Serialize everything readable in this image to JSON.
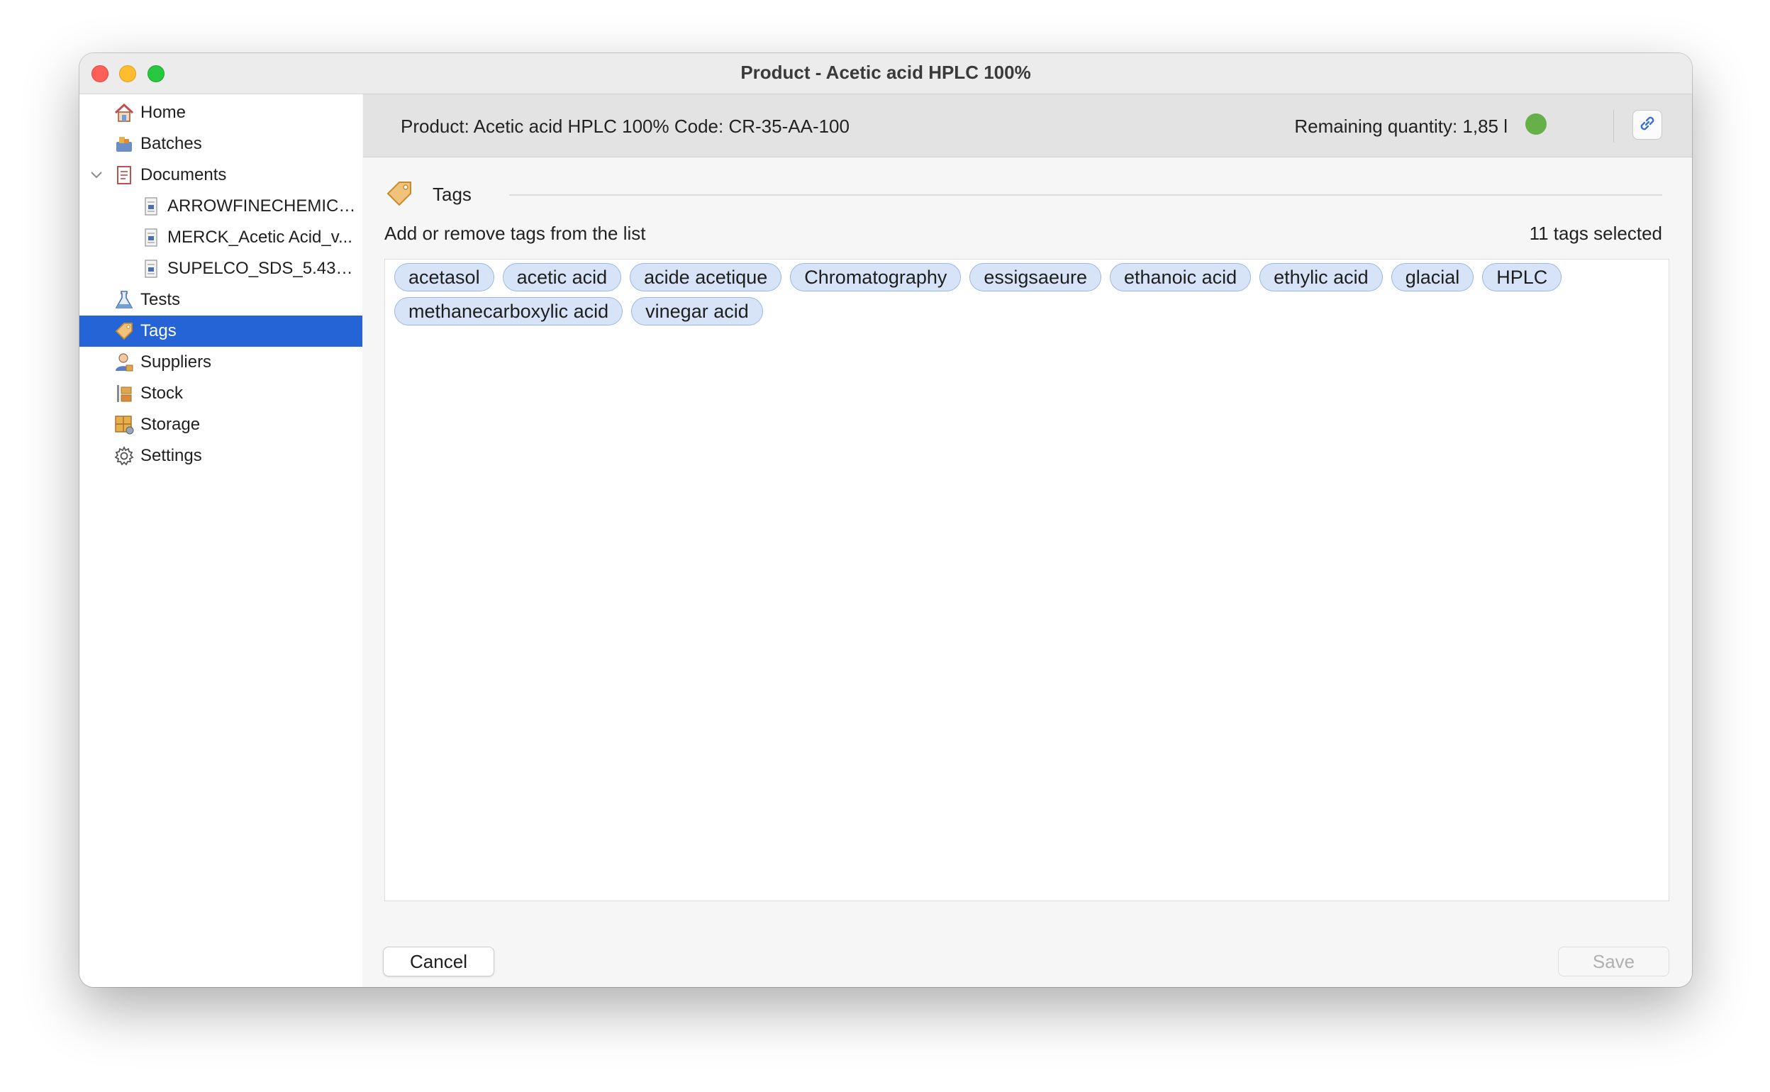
{
  "window": {
    "title": "Product - Acetic acid HPLC 100%"
  },
  "sidebar": {
    "items": [
      {
        "label": "Home",
        "icon": "home-icon"
      },
      {
        "label": "Batches",
        "icon": "batches-icon"
      },
      {
        "label": "Documents",
        "icon": "documents-icon",
        "expanded": true
      },
      {
        "label": "ARROWFINECHEMICA...",
        "icon": "pdf-file-icon"
      },
      {
        "label": "MERCK_Acetic Acid_v...",
        "icon": "pdf-file-icon"
      },
      {
        "label": "SUPELCO_SDS_5.438...",
        "icon": "pdf-file-icon"
      },
      {
        "label": "Tests",
        "icon": "flask-icon"
      },
      {
        "label": "Tags",
        "icon": "tag-icon",
        "selected": true
      },
      {
        "label": "Suppliers",
        "icon": "supplier-icon"
      },
      {
        "label": "Stock",
        "icon": "stock-icon"
      },
      {
        "label": "Storage",
        "icon": "storage-icon"
      },
      {
        "label": "Settings",
        "icon": "gear-icon"
      }
    ]
  },
  "header": {
    "product_info": "Product: Acetic acid HPLC 100% Code: CR-35-AA-100",
    "remaining": "Remaining quantity: 1,85 l",
    "status_color": "#66b04a"
  },
  "tags_section": {
    "title": "Tags",
    "instruction": "Add or remove tags from the list",
    "count_label": "11 tags selected",
    "tags": [
      "acetasol",
      "acetic acid",
      "acide acetique",
      "Chromatography",
      "essigsaeure",
      "ethanoic acid",
      "ethylic acid",
      "glacial",
      "HPLC",
      "methanecarboxylic acid",
      "vinegar acid"
    ]
  },
  "buttons": {
    "cancel": "Cancel",
    "save": "Save"
  },
  "colors": {
    "selection": "#2464d6",
    "chip_fill": "#d7e4f8",
    "chip_border": "#9bb9e6"
  }
}
